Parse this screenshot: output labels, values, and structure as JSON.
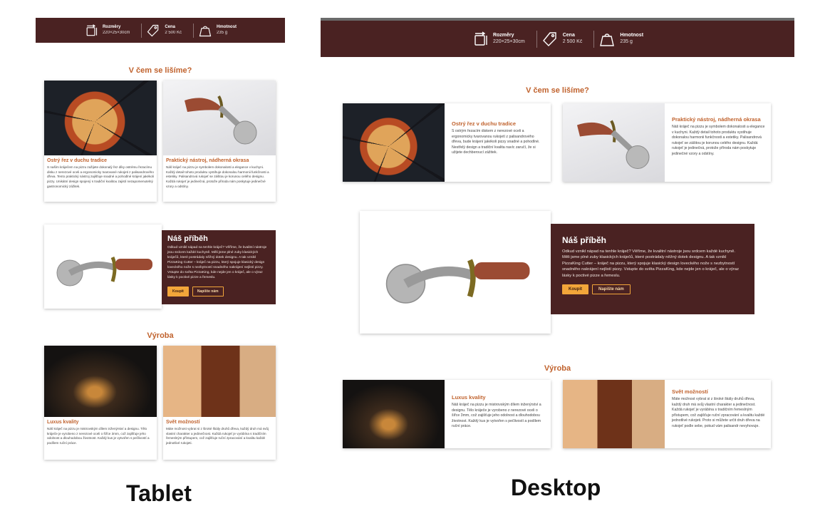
{
  "specs": [
    {
      "label": "Rozměry",
      "value": "220×25×30cm",
      "icon": "dimensions-icon"
    },
    {
      "label": "Cena",
      "value": "2 500 Kč",
      "icon": "price-tag-icon"
    },
    {
      "label": "Hmotnost",
      "value": "235 g",
      "icon": "weight-icon"
    }
  ],
  "difference": {
    "title": "V čem se lišíme?",
    "cards": [
      {
        "title": "Ostrý řez v duchu tradice",
        "text": "S naším kráječem na pizzu zažijete dokonalý řez díky ostrému řezacímu disku z nerezové oceli a ergonomicky tvarované rukojeti z palisandrového dřeva. Tento praktický nástroj zajišťuje snadné a pohodlné krájení jakékoli pizzy. Unikátní design spojený s tradiční kvalitou zajistí nezapomenutelný gastronomický zážitek."
      },
      {
        "title": "Praktický nástroj, nádherná okrasa",
        "text": "Náš kráječ na pizzu je symbolem dokonalosti a elegance v kuchyni. Každý detail tohoto produktu vystihuje dokonalou harmonii funkčnosti a estetiky. Palisandrová rukojeť se zášitou je korunou celého designu. Každá rukojeť je jedinečná, protože přiroda nám poskytuje jedinečné vzory a odstíny."
      }
    ],
    "desktop_cards": [
      {
        "title": "Ostrý řez v duchu tradice",
        "text": "S ostrým řezacím diskem z nerezové oceli a ergonomicky tvarovanou rukojetí z palisandrového dřeva, bude krájení jakékoli pizzy snadné a pohodlné. Nestřelý design a tradiční kvalita navíc zaručí, že si užijete dechberoucí zážitek."
      },
      {
        "title": "Praktický nástroj, nádherná okrasa",
        "text": "Náš kráječ na pizzu je symbolem dokonalosti a elegance v kuchyni. Každý detail tohoto produktu vystihuje dokonalou harmonii funkčnosti a estetiky. Palisandrová rukojeť se zášitou je korunou celého designu. Každá rukojeť je jedinečná, protože příroda nám poskytuje jedinečné vzory a odstíny."
      }
    ]
  },
  "story": {
    "title": "Náš příběh",
    "text": "Odkud vznikl nápad na tenhle kráječ? Věříme, že kvalitní nástroje jsou srdcem každé kuchyně. Měli jsme plné zuby klasických kráječů, které postrádaly něžný dotek designu. A tak vznikl PizzaKing Cutter – kráječ na pizzu, který spojuje klasický design loveckého nože s nezbytností snadného nakrájení nejlistí pizzy. Vstupte do světa PizzaKing, kde nejde jen o kráječ, ale o výraz lásky k poctivé pizze a řemeslu.",
    "buy_label": "Koupit",
    "contact_label": "Napište nám"
  },
  "production": {
    "title": "Výroba",
    "cards": [
      {
        "title": "Luxus kvality",
        "text": "Náš kráječ na pizzu je mistrovským dílem inženýrství a designu. Tělo kráječe je vyrobeno z nerezové oceli o šířce 3mm, což zajišťuje jeho odolnost a dlouhodobou životnost. Každý kus je vytvořen s pečlivostí a podílem ruční práce."
      },
      {
        "title": "Svět možností",
        "text": "Máte možnost vybrat si z široké škály druhů dřeva, každý druh má svůj vlastní charakter a jedinečnost. Každá rukojeť je vyrábína s tradičním řemeslným přístupem, což zajišťuje ruční zpracování a kvalitu každé jednotlivé rukojeti."
      }
    ],
    "desktop_cards": [
      {
        "title": "Luxus kvality",
        "text": "Náš kráječ na pizzu je mistrovským dílem inženýrství a designu. Tělo kráječe je vyrobeno z nerezové oceli o šířce 3mm, což zajišťuje jeho odolnost a dlouhodobou životnost. Každý kus je vytvořen s pečlivostí a podílem ruční práce."
      },
      {
        "title": "Svět možností",
        "text": "Máte možnost vybrat si z široké škály druhů dřeva, každý druh má svůj vlastní charakter a jedinečnost. Každá rukojeť je vyrábína s tradičním řemeslným přístupem, což zajišťuje ruční zpracování a kvalitu každé jednotlivé rukojeti. Proto si můžete určit druh dřeva na rukojeť podle sebe, pokud vám palisandr nevyhovuje."
      }
    ]
  },
  "labels": {
    "tablet": "Tablet",
    "desktop": "Desktop"
  },
  "colors": {
    "brand_brown": "#4a2222",
    "accent_orange": "#c0622d",
    "button_orange": "#f2a63a"
  }
}
